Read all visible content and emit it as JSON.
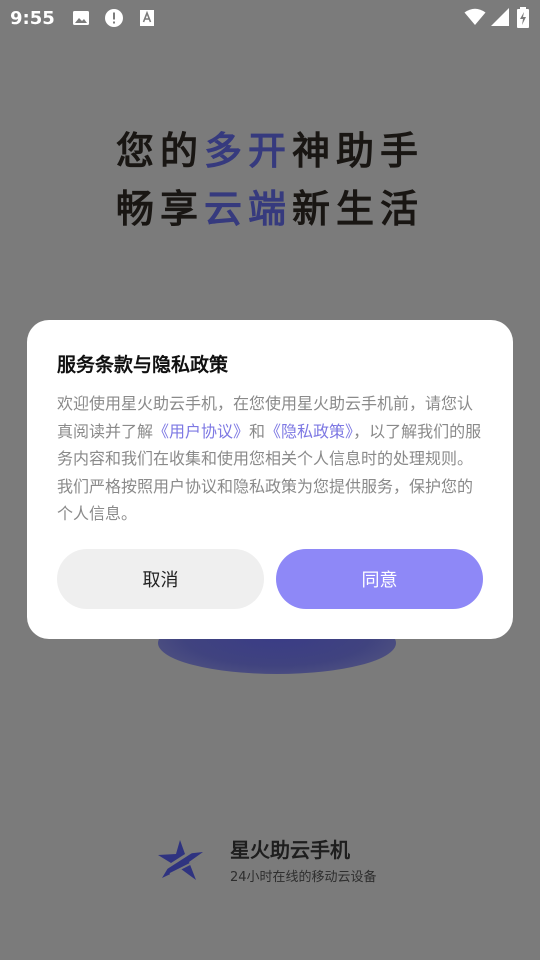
{
  "status_bar": {
    "time": "9:55",
    "icons": [
      "image-icon",
      "alert-icon",
      "a-icon",
      "wifi-icon",
      "signal-icon",
      "battery-charging-icon"
    ]
  },
  "headline": {
    "line1_part1": "您的",
    "line1_accent": "多开",
    "line1_part2": "神助手",
    "line2_part1": "畅享",
    "line2_accent": "云端",
    "line2_part2": "新生活",
    "accent_color": "#363a7e"
  },
  "dialog": {
    "title": "服务条款与隐私政策",
    "body_part1": "欢迎使用星火助云手机，在您使用星火助云手机前，请您认真阅读并了解",
    "user_agreement_link": "《用户协议》",
    "body_and": "和",
    "privacy_policy_link": "《隐私政策》",
    "body_part2": "，以了解我们的服务内容和我们在收集和使用您相关个人信息时的处理规则。我们严格按照用户协议和隐私政策为您提供服务，保护您的个人信息。",
    "cancel_label": "取消",
    "agree_label": "同意",
    "agree_color": "#8e88f7",
    "link_color": "#7d78e3"
  },
  "brand": {
    "name": "星火助云手机",
    "tagline": "24小时在线的移动云设备"
  }
}
